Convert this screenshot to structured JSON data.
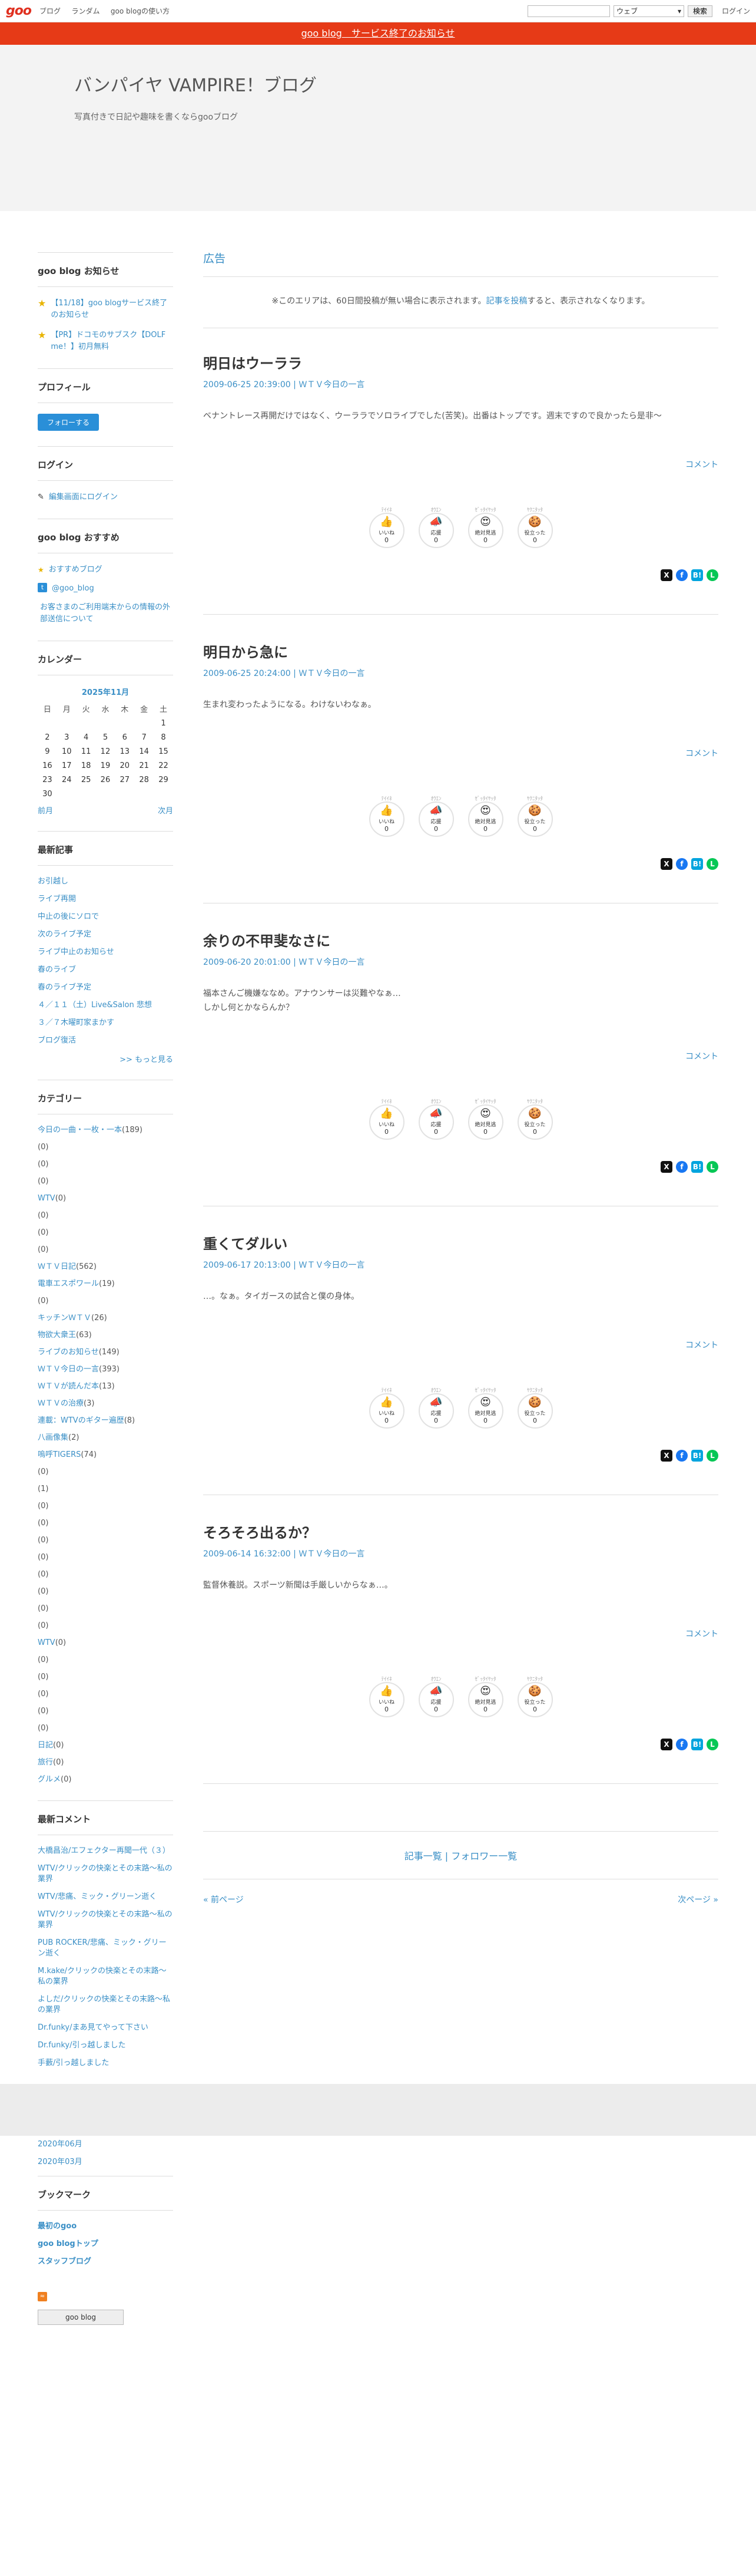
{
  "topbar": {
    "logo": "goo",
    "nav": [
      "ブログ",
      "ランダム",
      "goo blogの使い方"
    ],
    "search_placeholder": "",
    "select_value": "ウェブ",
    "search_button": "検索",
    "login": "ログイン"
  },
  "notice": {
    "text": "goo blog　サービス終了のお知らせ"
  },
  "header": {
    "title": "バンパイヤ VAMPIRE！ブログ",
    "description": "写真付きで日記や趣味を書くならgooブログ"
  },
  "sidebar": {
    "news_title": "goo blog お知らせ",
    "news": [
      "【11/18】goo blogサービス終了のお知らせ",
      "【PR】ドコモのサブスク【DOLF me！】初月無料"
    ],
    "profile_title": "プロフィール",
    "follow_button": "フォローする",
    "login_title": "ログイン",
    "login_link": "編集画面にログイン",
    "recommend_title": "goo blog おすすめ",
    "recommend_links": [
      "おすすめブログ",
      "@goo_blog",
      "お客さまのご利用端末からの情報の外部送信について"
    ],
    "calendar_title": "カレンダー",
    "calendar": {
      "caption": "2025年11月",
      "weekdays": [
        "日",
        "月",
        "火",
        "水",
        "木",
        "金",
        "土"
      ],
      "weeks": [
        [
          "",
          "",
          "",
          "",
          "",
          "",
          "1"
        ],
        [
          "2",
          "3",
          "4",
          "5",
          "6",
          "7",
          "8"
        ],
        [
          "9",
          "10",
          "11",
          "12",
          "13",
          "14",
          "15"
        ],
        [
          "16",
          "17",
          "18",
          "19",
          "20",
          "21",
          "22"
        ],
        [
          "23",
          "24",
          "25",
          "26",
          "27",
          "28",
          "29"
        ],
        [
          "30",
          "",
          "",
          "",
          "",
          "",
          ""
        ]
      ],
      "prev": "前月",
      "next": "次月"
    },
    "recent_title": "最新記事",
    "recent": [
      "お引越し",
      "ライブ再開",
      "中止の後にソロで",
      "次のライブ予定",
      "ライブ中止のお知らせ",
      "春のライブ",
      "春のライブ予定",
      "４／１１（土）Live&Salon 悲想",
      "３／７木曜町家まかす",
      "ブログ復活"
    ],
    "recent_more": ">> もっと見る",
    "category_title": "カテゴリー",
    "categories": [
      {
        "name": "今日の一曲・一枚・一本",
        "count": "(189)"
      },
      {
        "name": "",
        "count": "(0)"
      },
      {
        "name": "",
        "count": "(0)"
      },
      {
        "name": "",
        "count": "(0)"
      },
      {
        "name": "WTV",
        "count": "(0)"
      },
      {
        "name": "",
        "count": "(0)"
      },
      {
        "name": "",
        "count": "(0)"
      },
      {
        "name": "",
        "count": "(0)"
      },
      {
        "name": "ＷＴＶ日記",
        "count": "(562)"
      },
      {
        "name": "電車エスポワール",
        "count": "(19)"
      },
      {
        "name": "",
        "count": "(0)"
      },
      {
        "name": "キッチンＷＴＶ",
        "count": "(26)"
      },
      {
        "name": "物欲大衆王",
        "count": "(63)"
      },
      {
        "name": "ライブのお知らせ",
        "count": "(149)"
      },
      {
        "name": "ＷＴＶ今日の一言",
        "count": "(393)"
      },
      {
        "name": "ＷＴＶが読んだ本",
        "count": "(13)"
      },
      {
        "name": "ＷＴＶの治療",
        "count": "(3)"
      },
      {
        "name": "連載：WTVのギター遍歴",
        "count": "(8)"
      },
      {
        "name": "八画像集",
        "count": "(2)"
      },
      {
        "name": "嗚呼TIGERS",
        "count": "(74)"
      },
      {
        "name": "",
        "count": "(0)"
      },
      {
        "name": "",
        "count": "(1)"
      },
      {
        "name": "",
        "count": "(0)"
      },
      {
        "name": "",
        "count": "(0)"
      },
      {
        "name": "",
        "count": "(0)"
      },
      {
        "name": "",
        "count": "(0)"
      },
      {
        "name": "",
        "count": "(0)"
      },
      {
        "name": "",
        "count": "(0)"
      },
      {
        "name": "",
        "count": "(0)"
      },
      {
        "name": "",
        "count": "(0)"
      },
      {
        "name": "WTV",
        "count": "(0)"
      },
      {
        "name": "",
        "count": "(0)"
      },
      {
        "name": "",
        "count": "(0)"
      },
      {
        "name": "",
        "count": "(0)"
      },
      {
        "name": "",
        "count": "(0)"
      },
      {
        "name": "",
        "count": "(0)"
      },
      {
        "name": "日記",
        "count": "(0)"
      },
      {
        "name": "旅行",
        "count": "(0)"
      },
      {
        "name": "グルメ",
        "count": "(0)"
      }
    ],
    "comments_title": "最新コメント",
    "comments": [
      "大橋昌治/エフェクター再聞一代（３）",
      "WTV/クリックの快楽とその末路～私の業界",
      "WTV/悲痛、ミック・グリーン逝く",
      "WTV/クリックの快楽とその末路～私の業界",
      "PUB ROCKER/悲痛、ミック・グリーン逝く",
      "M.kake/クリックの快楽とその末路～私の業界",
      "よしだ/クリックの快楽とその末路～私の業界",
      "Dr.funky/まあ見てやって下さい",
      "Dr.funky/引っ越しました",
      "手藪/引っ越しました"
    ]
  },
  "main": {
    "ad_title": "広告",
    "ad_note_prefix": "※このエリアは、60日間投稿が無い場合に表示されます。",
    "ad_note_link": "記事を投稿",
    "ad_note_suffix": "すると、表示されなくなります。",
    "comment_label": "コメント",
    "reactions": [
      {
        "top": "ﾃｲｲﾈ",
        "emoji": "👍",
        "label": "いいね",
        "count": "0"
      },
      {
        "top": "ｵｳｴﾝ",
        "emoji": "📣",
        "label": "応援",
        "count": "0"
      },
      {
        "top": "ｾﾞｯﾀｲﾔｯﾀ",
        "emoji": "😍",
        "label": "絶対見逃",
        "count": "0"
      },
      {
        "top": "ﾔｸﾆﾀｯﾀ",
        "emoji": "🍪",
        "label": "役立った",
        "count": "0"
      }
    ],
    "share": [
      "X",
      "f",
      "B!",
      "L"
    ],
    "posts": [
      {
        "title": "明日はウーララ",
        "date": "2009-06-25 20:39:00",
        "category": "ＷＴＶ今日の一言",
        "body": [
          "ベナントレース再開だけではなく、ウーララでソロライブでした(苦笑)。出番はトップです。週末ですので良かったら是非～"
        ]
      },
      {
        "title": "明日から急に",
        "date": "2009-06-25 20:24:00",
        "category": "ＷＴＶ今日の一言",
        "body": [
          "生まれ変わったようになる。わけないわなぁ。"
        ]
      },
      {
        "title": "余りの不甲斐なさに",
        "date": "2009-06-20 20:01:00",
        "category": "ＷＴＶ今日の一言",
        "body": [
          "福本さんご機嫌ななめ。アナウンサーは災難やなぁ…",
          "しかし何とかならんか？"
        ]
      },
      {
        "title": "重くてダルい",
        "date": "2009-06-17 20:13:00",
        "category": "ＷＴＶ今日の一言",
        "body": [
          "…。なぁ。タイガースの試合と僕の身体。"
        ]
      },
      {
        "title": "そろそろ出るか？",
        "date": "2009-06-14 16:32:00",
        "category": "ＷＴＶ今日の一言",
        "body": [
          "監督休養説。スポーツ新聞は手厳しいからなぁ…。"
        ]
      }
    ],
    "list_links": "記事一覧 | フォロワー一覧",
    "prev_page": "« 前ページ",
    "next_page": "次ページ »"
  },
  "after": {
    "archives": [
      "2020年06月",
      "2020年03月"
    ],
    "bookmark_title": "ブックマーク",
    "bookmarks": [
      "最初のgoo",
      "goo blogトップ",
      "スタッフブログ"
    ],
    "badge": "goo blog"
  }
}
